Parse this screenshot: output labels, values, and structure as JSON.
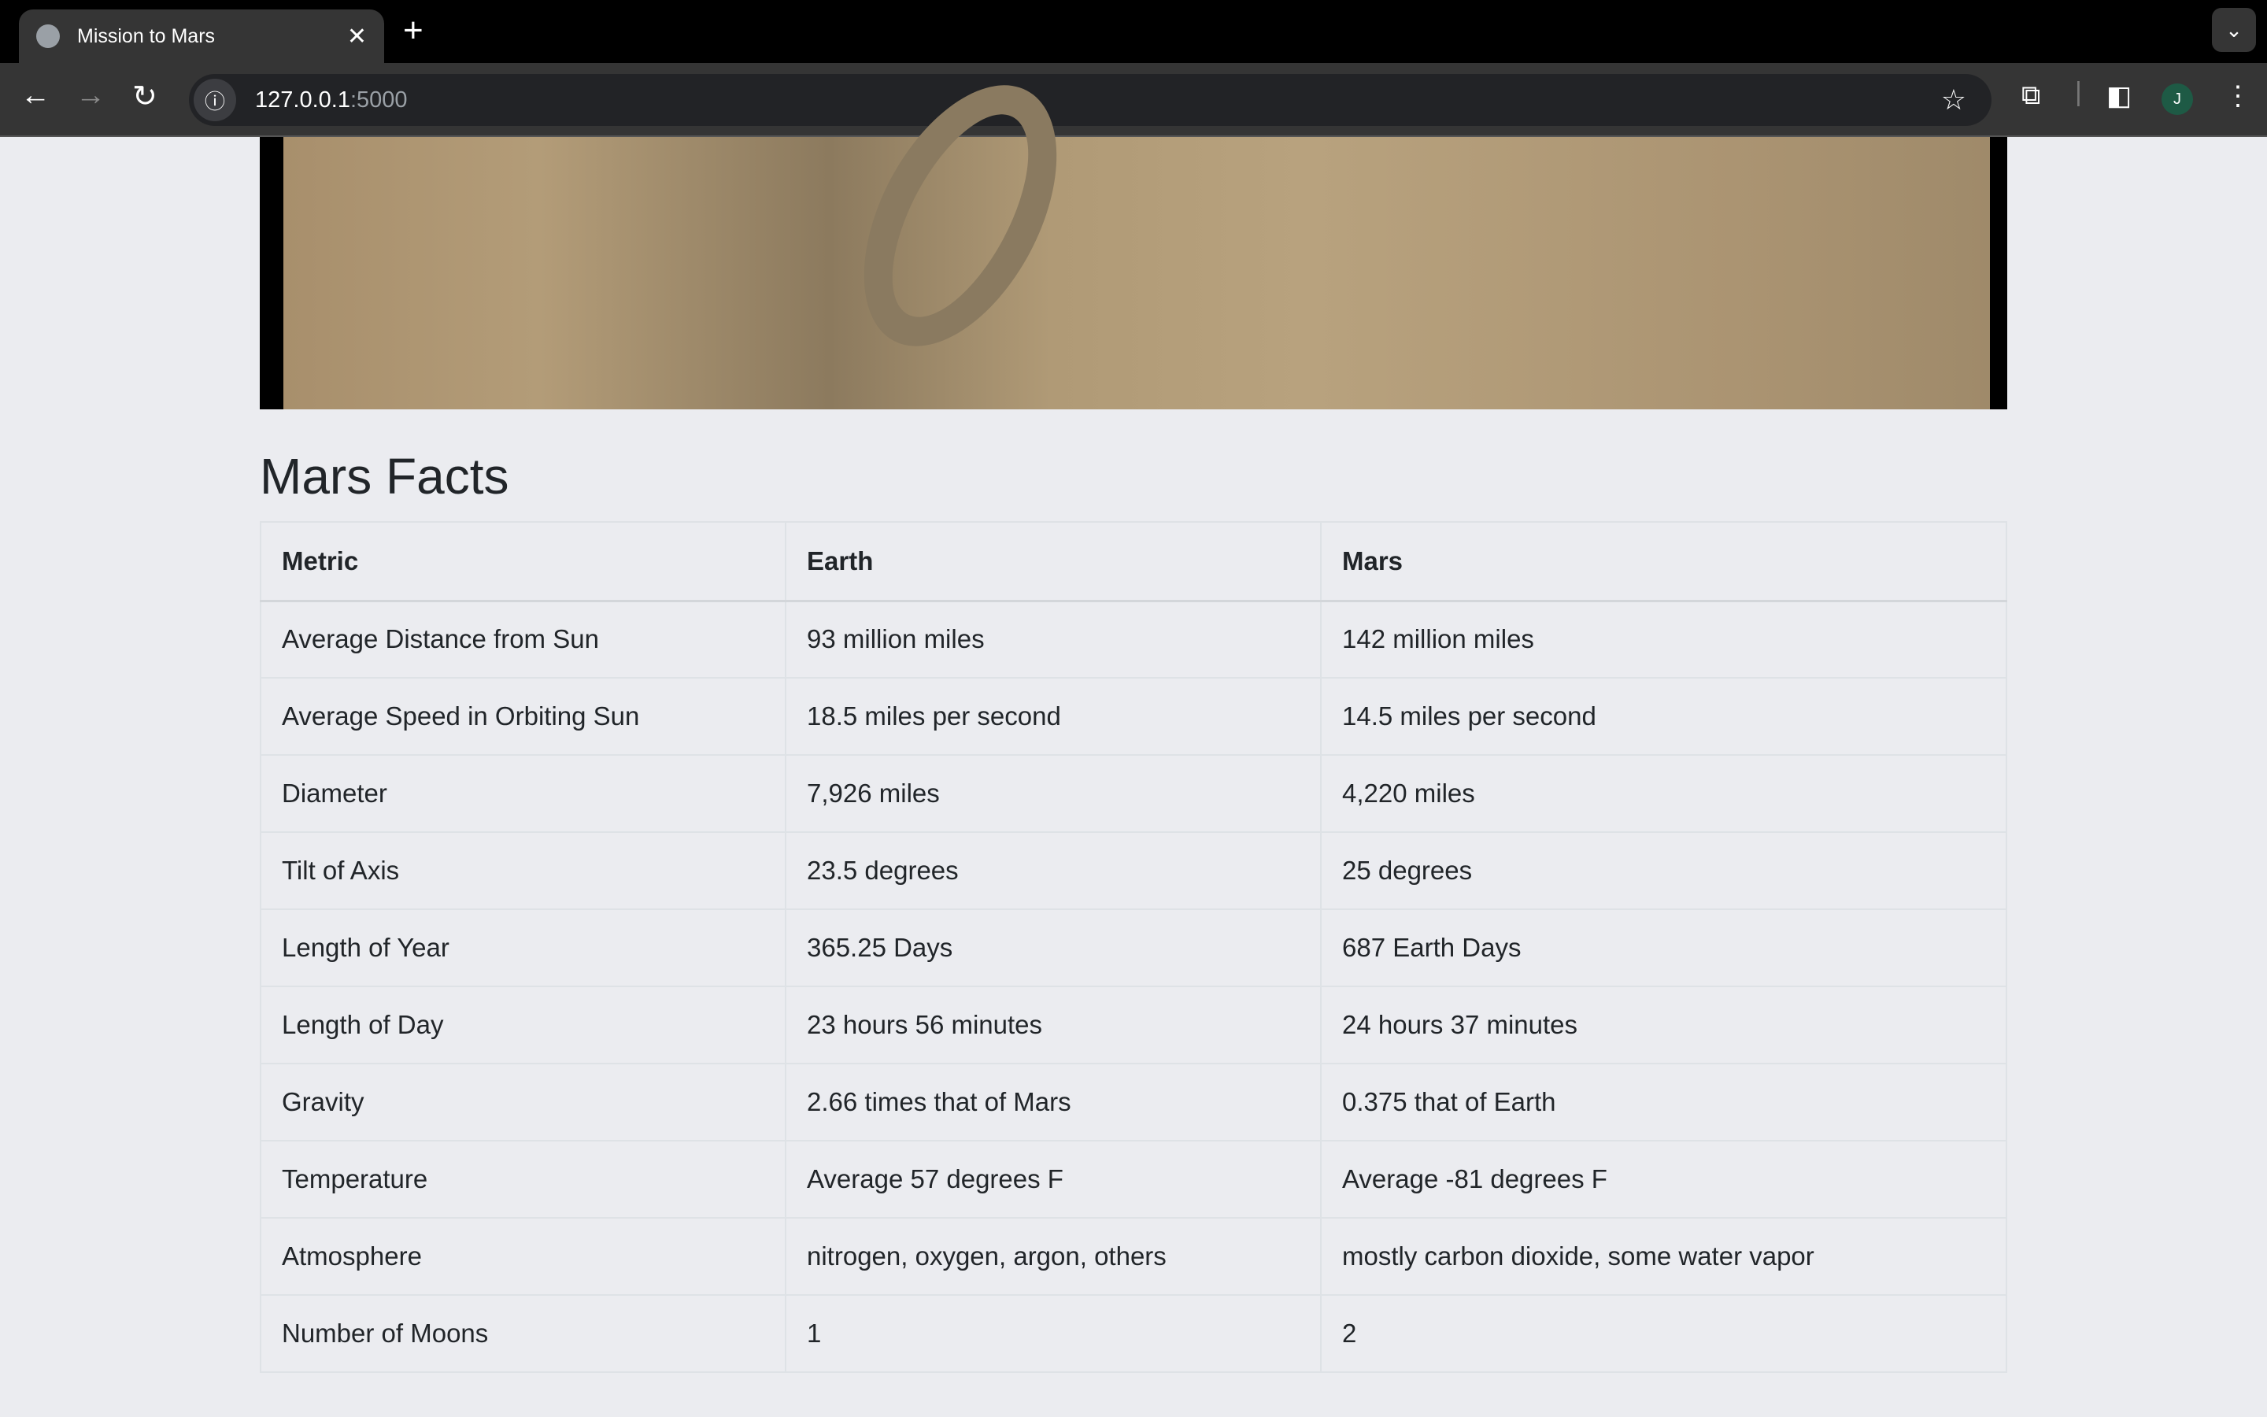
{
  "browser": {
    "tab_title": "Mission to Mars",
    "url_host": "127.0.0.1",
    "url_port": ":5000",
    "avatar": "J"
  },
  "page": {
    "heading": "Mars Facts",
    "table": {
      "headers": [
        "Metric",
        "Earth",
        "Mars"
      ],
      "rows": [
        [
          "Average Distance from Sun",
          "93 million miles",
          "142 million miles"
        ],
        [
          "Average Speed in Orbiting Sun",
          "18.5 miles per second",
          "14.5 miles per second"
        ],
        [
          "Diameter",
          "7,926 miles",
          "4,220 miles"
        ],
        [
          "Tilt of Axis",
          "23.5 degrees",
          "25 degrees"
        ],
        [
          "Length of Year",
          "365.25 Days",
          "687 Earth Days"
        ],
        [
          "Length of Day",
          "23 hours 56 minutes",
          "24 hours 37 minutes"
        ],
        [
          "Gravity",
          "2.66 times that of Mars",
          "0.375 that of Earth"
        ],
        [
          "Temperature",
          "Average 57 degrees F",
          "Average -81 degrees F"
        ],
        [
          "Atmosphere",
          "nitrogen, oxygen, argon, others",
          "mostly carbon dioxide, some water vapor"
        ],
        [
          "Number of Moons",
          "1",
          "2"
        ]
      ]
    }
  }
}
